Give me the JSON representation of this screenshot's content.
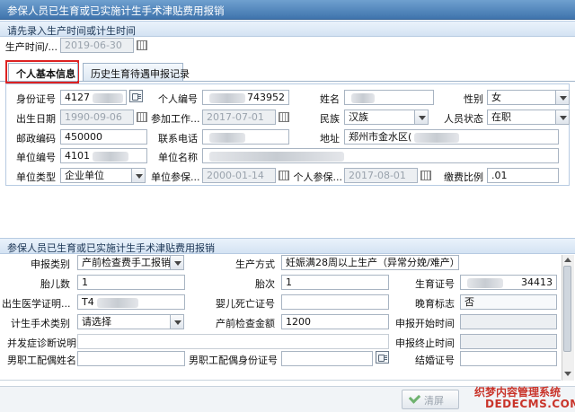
{
  "window": {
    "title": "参保人员已生育或已实施计生手术津贴费用报销"
  },
  "top_hint": "请先录入生产时间或计生时间",
  "birth_time": {
    "label": "生产时间/...",
    "value": "2019-06-30"
  },
  "tabs": [
    {
      "label": "个人基本信息",
      "active": true
    },
    {
      "label": "历史生育待遇申报记录",
      "active": false
    }
  ],
  "personal": {
    "id_no": {
      "label": "身份证号",
      "value": "4127"
    },
    "person_no": {
      "label": "个人编号",
      "value": "743952"
    },
    "name": {
      "label": "姓名",
      "value": ""
    },
    "gender": {
      "label": "性别",
      "value": "女"
    },
    "birth_date": {
      "label": "出生日期",
      "value": "1990-09-06"
    },
    "work_date": {
      "label": "参加工作...",
      "value": "2017-07-01"
    },
    "ethnicity": {
      "label": "民族",
      "value": "汉族"
    },
    "status": {
      "label": "人员状态",
      "value": "在职"
    },
    "postcode": {
      "label": "邮政编码",
      "value": "450000"
    },
    "phone": {
      "label": "联系电话",
      "value": ""
    },
    "address": {
      "label": "地址",
      "value": "郑州市金水区("
    },
    "unit_no": {
      "label": "单位编号",
      "value": "4101"
    },
    "unit_name": {
      "label": "单位名称",
      "value": ""
    },
    "unit_type": {
      "label": "单位类型",
      "value": "企业单位"
    },
    "unit_ins_date": {
      "label": "单位参保...",
      "value": "2000-01-14"
    },
    "person_ins_date": {
      "label": "个人参保...",
      "value": "2017-08-01"
    },
    "pay_ratio": {
      "label": "缴费比例",
      "value": ".01"
    }
  },
  "section2_title": "参保人员已生育或已实施计生手术津贴费用报销",
  "claim": {
    "claim_type": {
      "label": "申报类别",
      "value": "产前检查费手工报销"
    },
    "delivery_method": {
      "label": "生产方式",
      "value": "妊娠满28周以上生产（异常分娩/难产）"
    },
    "fetus_count": {
      "label": "胎儿数",
      "value": "1"
    },
    "parity": {
      "label": "胎次",
      "value": "1"
    },
    "birth_permit": {
      "label": "生育证号",
      "value": "34413"
    },
    "birth_cert": {
      "label": "出生医学证明...",
      "value": "T4"
    },
    "infant_death": {
      "label": "婴儿死亡证号",
      "value": ""
    },
    "late_birth": {
      "label": "晚育标志",
      "value": "否"
    },
    "surgery_type": {
      "label": "计生手术类别",
      "value": "请选择"
    },
    "prenatal_amount": {
      "label": "产前检查金额",
      "value": "1200"
    },
    "claim_start": {
      "label": "申报开始时间",
      "value": ""
    },
    "complication": {
      "label": "并发症诊断说明",
      "value": ""
    },
    "claim_end": {
      "label": "申报终止时间",
      "value": ""
    },
    "spouse_name": {
      "label": "男职工配偶姓名",
      "value": ""
    },
    "spouse_id": {
      "label": "男职工配偶身份证号",
      "value": ""
    },
    "marriage_cert": {
      "label": "结婚证号",
      "value": ""
    }
  },
  "buttons": {
    "clear": "清屏"
  },
  "watermark": {
    "line1": "织梦内容管理系统",
    "line2": "DEDECMS.COM"
  }
}
